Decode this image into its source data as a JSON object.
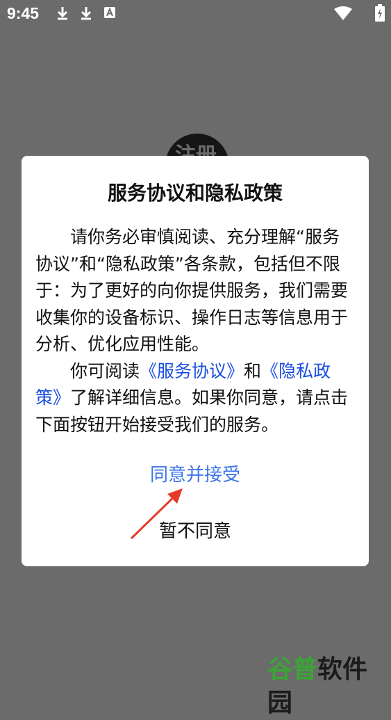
{
  "status_bar": {
    "time": "9:45",
    "icons": [
      "download-icon",
      "download-icon",
      "app-notification-icon",
      "wifi-icon",
      "battery-charging-icon"
    ]
  },
  "background": {
    "logo_text": "注册"
  },
  "dialog": {
    "title": "服务协议和隐私政策",
    "paragraph1": "请你务必审慎阅读、充分理解“服务协议”和“隐私政策”各条款，包括但不限于：为了更好的向你提供服务，我们需要收集你的设备标识、操作日志等信息用于分析、优化应用性能。",
    "paragraph2_prefix": "你可阅读",
    "service_agreement_link": "《服务协议》",
    "paragraph2_and": "和",
    "privacy_policy_link": "《隐私政策》",
    "paragraph2_suffix": "了解详细信息。如果你同意，请点击下面按钮开始接受我们的服务。",
    "accept_label": "同意并接受",
    "decline_label": "暂不同意"
  },
  "watermark": {
    "text": "谷普软件园"
  },
  "colors": {
    "overlay": "#6b6b6b",
    "link": "#1a4ee0",
    "accept": "#3a73e8",
    "annotation_arrow": "#e53a2a",
    "watermark_green": "#3aa535"
  }
}
